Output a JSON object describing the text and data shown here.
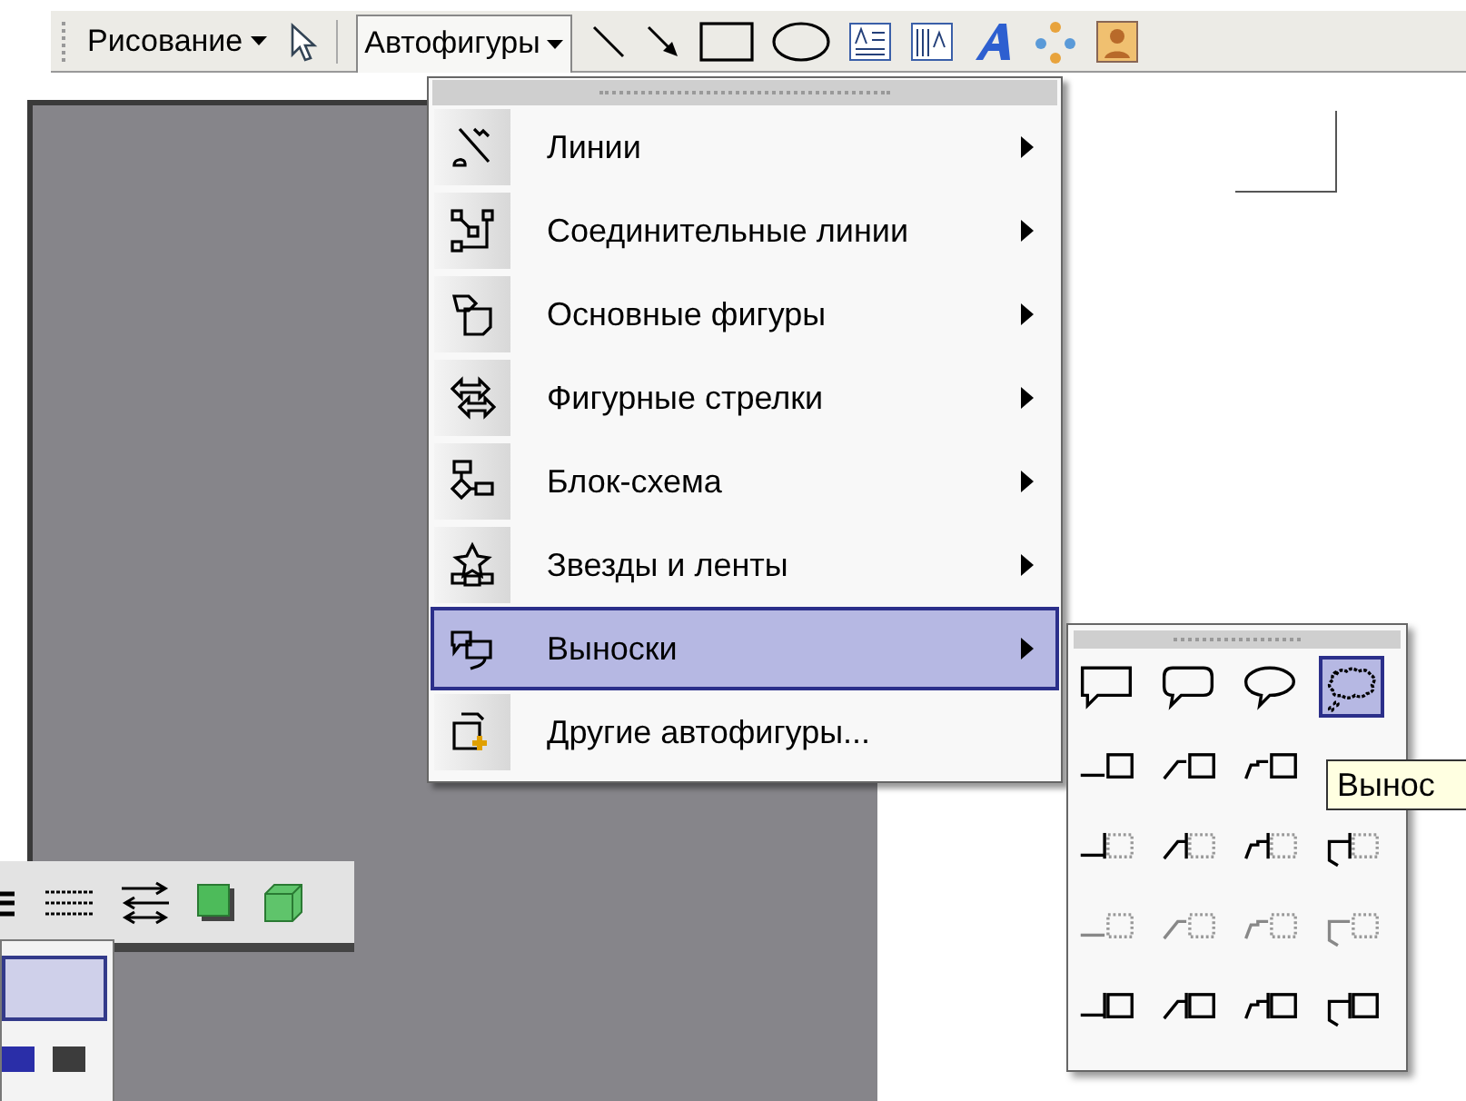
{
  "toolbar": {
    "drawing_menu": {
      "label": "Рисование"
    },
    "autoshapes_menu": {
      "label": "Автофигуры",
      "pressed": true
    }
  },
  "autoshapes_menu": {
    "items": [
      {
        "kind": "lines",
        "label": "Линии",
        "has_submenu": true,
        "selected": false
      },
      {
        "kind": "connectors",
        "label": "Соединительные линии",
        "has_submenu": true,
        "selected": false
      },
      {
        "kind": "basic",
        "label": "Основные фигуры",
        "has_submenu": true,
        "selected": false
      },
      {
        "kind": "arrows",
        "label": "Фигурные стрелки",
        "has_submenu": true,
        "selected": false
      },
      {
        "kind": "flowchart",
        "label": "Блок-схема",
        "has_submenu": true,
        "selected": false
      },
      {
        "kind": "stars",
        "label": "Звезды и ленты",
        "has_submenu": true,
        "selected": false
      },
      {
        "kind": "callouts",
        "label": "Выноски",
        "has_submenu": true,
        "selected": true
      },
      {
        "kind": "more",
        "label": "Другие автофигуры...",
        "has_submenu": false,
        "selected": false
      }
    ]
  },
  "callouts_menu": {
    "rows": [
      {
        "kind": "balloons",
        "items": [
          {
            "kind": "rect",
            "selected": false
          },
          {
            "kind": "rounded",
            "selected": false
          },
          {
            "kind": "oval",
            "selected": false
          },
          {
            "kind": "cloud",
            "selected": true
          }
        ]
      },
      {
        "kind": "solid",
        "items": [
          {
            "kind": "straight",
            "selected": false
          },
          {
            "kind": "angled",
            "selected": false
          },
          {
            "kind": "bent",
            "selected": false
          }
        ]
      },
      {
        "kind": "dotted",
        "items": [
          {
            "kind": "straight",
            "selected": false
          },
          {
            "kind": "angled",
            "selected": false
          },
          {
            "kind": "bent",
            "selected": false
          },
          {
            "kind": "double",
            "selected": false
          }
        ]
      },
      {
        "kind": "faint",
        "items": [
          {
            "kind": "straight",
            "selected": false
          },
          {
            "kind": "angled",
            "selected": false
          },
          {
            "kind": "bent",
            "selected": false
          },
          {
            "kind": "double",
            "selected": false
          }
        ]
      },
      {
        "kind": "accent",
        "items": [
          {
            "kind": "straight",
            "selected": false
          },
          {
            "kind": "angled",
            "selected": false
          },
          {
            "kind": "bent",
            "selected": false
          },
          {
            "kind": "double",
            "selected": false
          }
        ]
      }
    ]
  },
  "tooltip": "Вынос",
  "lower_panel": {
    "rows": [
      {
        "selected": true
      }
    ]
  }
}
